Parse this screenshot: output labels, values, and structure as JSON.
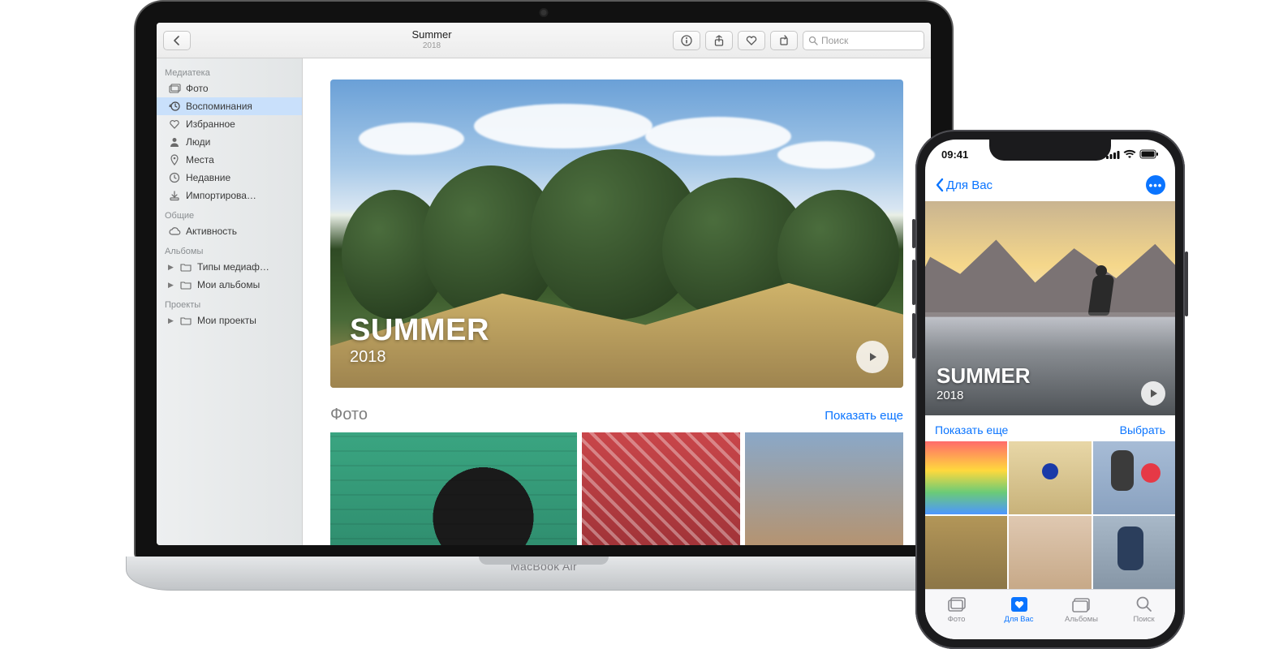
{
  "mac": {
    "toolbar": {
      "back_icon": "chevron-left",
      "title": "Summer",
      "subtitle": "2018",
      "info_icon": "info",
      "share_icon": "share",
      "heart_icon": "heart",
      "rotate_icon": "rotate",
      "search_placeholder": "Поиск"
    },
    "sidebar": {
      "sections": {
        "library_label": "Медиатека",
        "shared_label": "Общие",
        "albums_label": "Альбомы",
        "projects_label": "Проекты"
      },
      "library": [
        {
          "icon": "photo-stack",
          "label": "Фото"
        },
        {
          "icon": "clock-back",
          "label": "Воспоминания",
          "active": true
        },
        {
          "icon": "heart",
          "label": "Избранное"
        },
        {
          "icon": "person",
          "label": "Люди"
        },
        {
          "icon": "pin",
          "label": "Места"
        },
        {
          "icon": "clock",
          "label": "Недавние"
        },
        {
          "icon": "download",
          "label": "Импортирова…"
        }
      ],
      "shared": [
        {
          "icon": "cloud",
          "label": "Активность"
        }
      ],
      "albums": [
        {
          "icon": "folder",
          "label": "Типы медиаф…",
          "disclosure": true
        },
        {
          "icon": "folder",
          "label": "Мои альбомы",
          "disclosure": true
        }
      ],
      "projects": [
        {
          "icon": "folder",
          "label": "Мои проекты",
          "disclosure": true
        }
      ]
    },
    "hero": {
      "title": "SUMMER",
      "year": "2018",
      "play_icon": "play"
    },
    "photos_section": {
      "heading": "Фото",
      "show_more": "Показать еще"
    },
    "base_label": "MacBook Air"
  },
  "iphone": {
    "status": {
      "time": "09:41"
    },
    "nav": {
      "back_label": "Для Вас",
      "more_icon": "more"
    },
    "hero": {
      "title": "SUMMER",
      "year": "2018",
      "play_icon": "play"
    },
    "row": {
      "show_more": "Показать еще",
      "select": "Выбрать"
    },
    "tabs": [
      {
        "icon": "photo-stack",
        "label": "Фото"
      },
      {
        "icon": "heart-square",
        "label": "Для Вас",
        "active": true
      },
      {
        "icon": "albums",
        "label": "Альбомы"
      },
      {
        "icon": "search",
        "label": "Поиск"
      }
    ]
  }
}
